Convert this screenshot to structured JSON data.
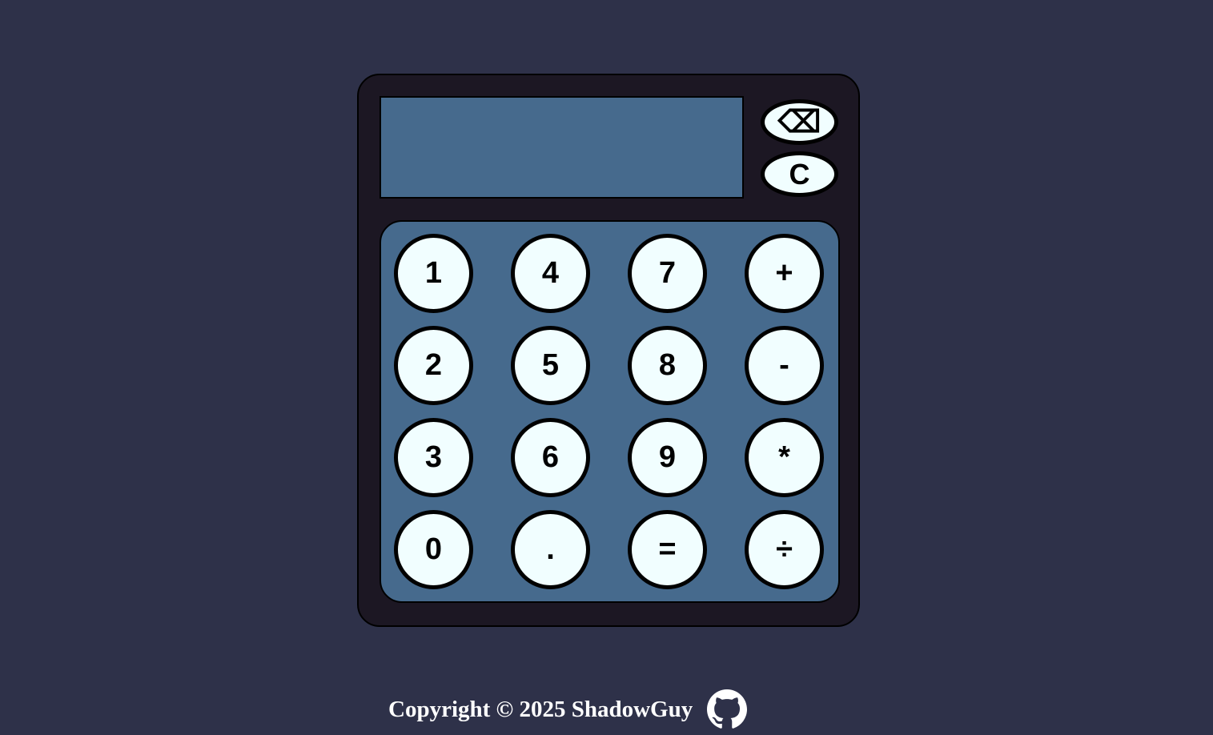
{
  "display": {
    "value": ""
  },
  "controls": {
    "backspace_label": "⌫",
    "clear_label": "C"
  },
  "keypad": {
    "keys": [
      [
        "1",
        "4",
        "7",
        "+"
      ],
      [
        "2",
        "5",
        "8",
        "-"
      ],
      [
        "3",
        "6",
        "9",
        "*"
      ],
      [
        "0",
        ".",
        "=",
        "÷"
      ]
    ]
  },
  "footer": {
    "copyright": "Copyright © 2025 ShadowGuy",
    "icon": "github-icon"
  },
  "colors": {
    "background": "#2e3149",
    "body": "#1c1723",
    "panel": "#466a8d",
    "button": "#f1feff"
  }
}
